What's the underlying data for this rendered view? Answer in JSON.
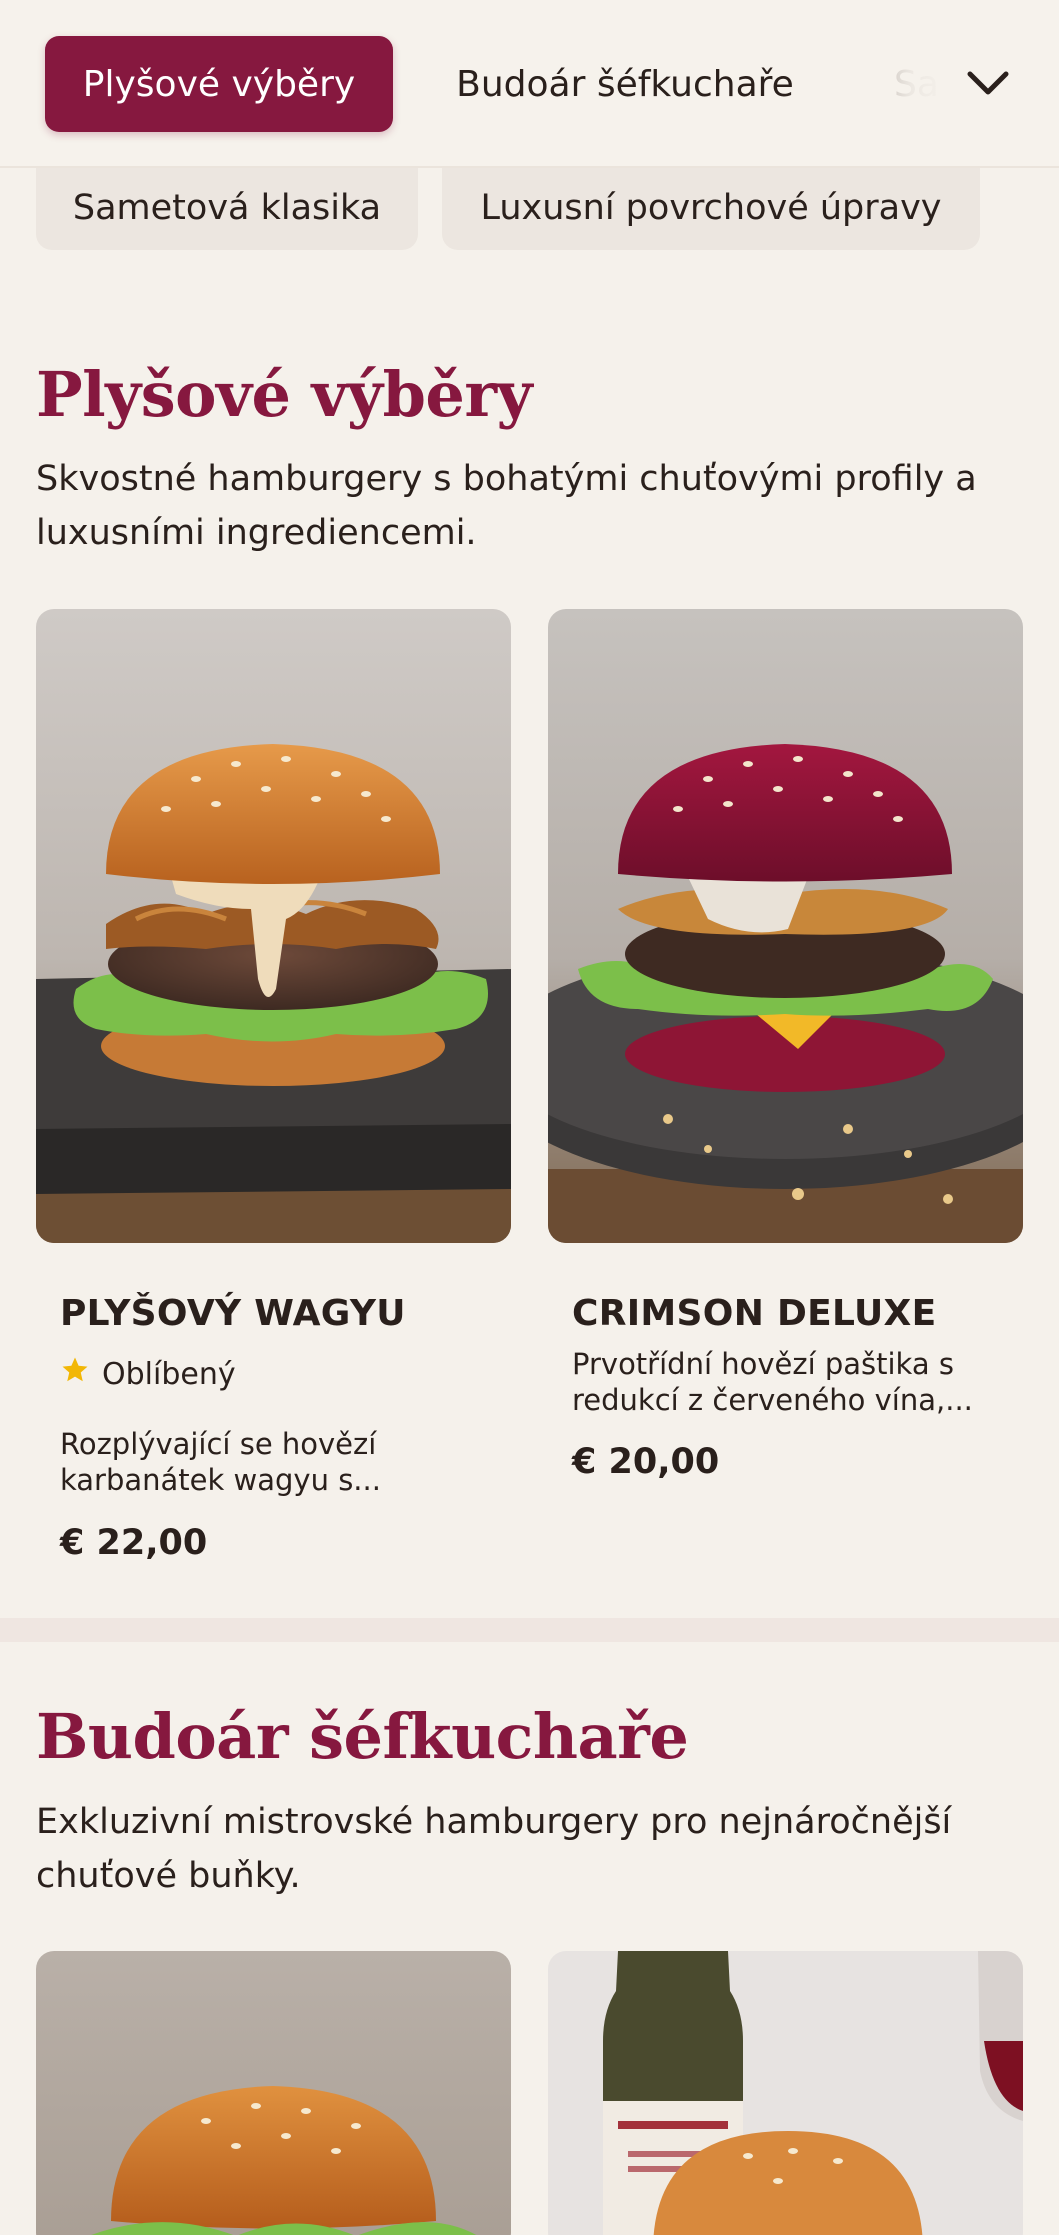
{
  "tabs": [
    {
      "label": "Plyšové výběry",
      "active": true
    },
    {
      "label": "Budoár šéfkuchaře",
      "active": false
    },
    {
      "label": "Sa",
      "active": false
    }
  ],
  "tabs_menu_icon": "chevron-down-icon",
  "chips": [
    {
      "label": "Sametová klasika"
    },
    {
      "label": "Luxusní povrchové úpravy"
    }
  ],
  "sections": [
    {
      "title": "Plyšové výběry",
      "description": "Skvostné hamburgery s bohatými chuťovými profily a luxusními ingrediencemi.",
      "products": [
        {
          "name": "PLYŠOVÝ WAGYU",
          "badge": "Oblíbený",
          "badge_icon": "star-icon",
          "description_line1": "Rozplývající se hovězí",
          "description_line2": "karbanátek wagyu s...",
          "price": "€ 22,00"
        },
        {
          "name": "CRIMSON DELUXE",
          "description_line1": "Prvotřídní hovězí paštika s",
          "description_line2": "redukcí z červeného vína,...",
          "price": "€ 20,00"
        }
      ]
    },
    {
      "title": "Budoár šéfkuchaře",
      "description": "Exkluzivní mistrovské hamburgery pro nejnáročnější chuťové buňky."
    }
  ],
  "colors": {
    "accent": "#86183f",
    "background": "#f5f1eb",
    "chip_bg": "#ece6e0",
    "star": "#f2b705",
    "text": "#2a201c"
  }
}
